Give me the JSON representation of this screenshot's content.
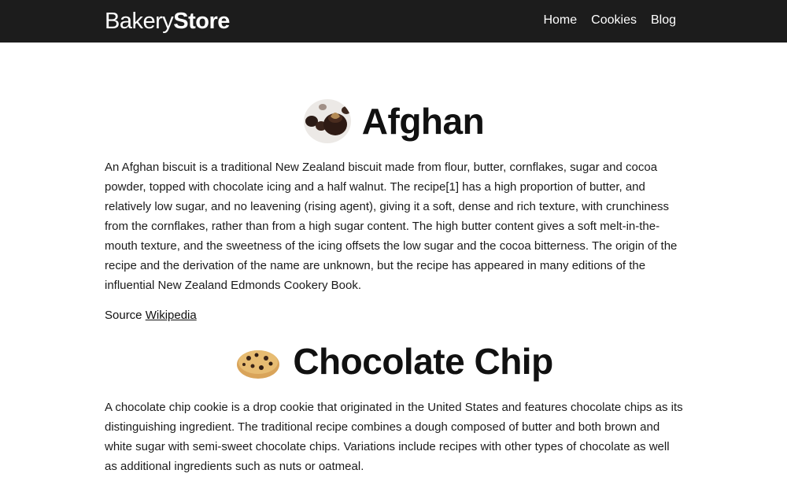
{
  "navbar": {
    "brand_light": "Bakery",
    "brand_bold": "Store",
    "links": [
      "Home",
      "Cookies",
      "Blog"
    ]
  },
  "articles": [
    {
      "title": "Afghan",
      "image_icon": "afghan-biscuit-image",
      "description": "An Afghan biscuit is a traditional New Zealand biscuit made from flour, butter, cornflakes, sugar and cocoa powder, topped with chocolate icing and a half walnut. The recipe[1] has a high proportion of butter, and relatively low sugar, and no leavening (rising agent), giving it a soft, dense and rich texture, with crunchiness from the cornflakes, rather than from a high sugar content. The high butter content gives a soft melt-in-the-mouth texture, and the sweetness of the icing offsets the low sugar and the cocoa bitterness. The origin of the recipe and the derivation of the name are unknown, but the recipe has appeared in many editions of the influential New Zealand Edmonds Cookery Book.",
      "source_label": "Source",
      "source_link": "Wikipedia"
    },
    {
      "title": "Chocolate Chip",
      "image_icon": "chocolate-chip-cookie-image",
      "description": "A chocolate chip cookie is a drop cookie that originated in the United States and features chocolate chips as its distinguishing ingredient. The traditional recipe combines a dough composed of butter and both brown and white sugar with semi-sweet chocolate chips. Variations include recipes with other types of chocolate as well as additional ingredients such as nuts or oatmeal."
    }
  ]
}
